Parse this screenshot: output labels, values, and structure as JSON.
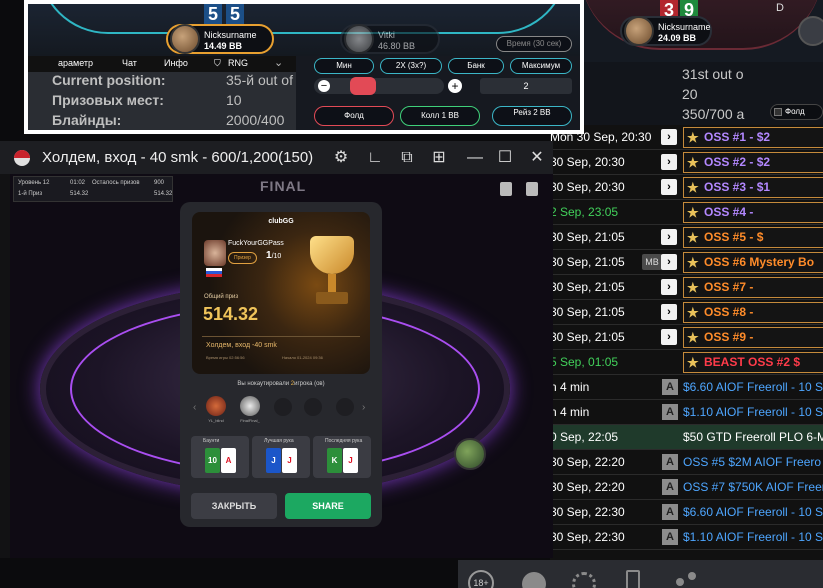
{
  "bg_table": {
    "digits": [
      "3",
      "9"
    ],
    "dealer": "D",
    "player": {
      "name": "Nicksurname",
      "stack": "24.09 BB"
    }
  },
  "lobby": {
    "rows": [
      {
        "date": "Mon 30 Sep, 20:30",
        "name": "OSS #1 - $2",
        "name_color": "#b388ff",
        "type": "star"
      },
      {
        "date": "30 Sep, 20:30",
        "name": "OSS #2 - $2",
        "name_color": "#b388ff",
        "type": "star"
      },
      {
        "date": "30 Sep, 20:30",
        "name": "OSS #3 - $1",
        "name_color": "#b388ff",
        "type": "star"
      },
      {
        "date": "2 Sep, 23:05",
        "date_color": "#42d15b",
        "name": "OSS #4 -",
        "name_color": "#b388ff",
        "type": "star_noarrow"
      },
      {
        "date": "30 Sep, 21:05",
        "name": "OSS #5 - $",
        "name_color": "#ff8c2a",
        "type": "star"
      },
      {
        "date": "30 Sep, 21:05",
        "mb": "MB",
        "name": "OSS #6 Mystery Bo",
        "name_color": "#ff8c2a",
        "type": "star"
      },
      {
        "date": "30 Sep, 21:05",
        "name": "OSS #7 -",
        "name_color": "#ff8c2a",
        "type": "star"
      },
      {
        "date": "30 Sep, 21:05",
        "name": "OSS #8 -",
        "name_color": "#ff8c2a",
        "type": "star"
      },
      {
        "date": "30 Sep, 21:05",
        "name": "OSS #9 -",
        "name_color": "#ff8c2a",
        "type": "star"
      },
      {
        "date": "5 Sep, 01:05",
        "date_color": "#42d15b",
        "name": "BEAST OSS #2 $",
        "name_color": "#ff3b4a",
        "type": "star_noarrow"
      },
      {
        "date": "n 4 min",
        "name": "$6.60 AIOF Freeroll - 10 S",
        "name_color": "#4ea6ff",
        "type": "a"
      },
      {
        "date": "n 4 min",
        "name": "$1.10 AIOF Freeroll - 10 S",
        "name_color": "#4ea6ff",
        "type": "a"
      },
      {
        "date": "0 Sep, 22:05",
        "name": "$50 GTD Freeroll PLO 6-Ma",
        "name_color": "#ffffff",
        "type": "plain",
        "bg": "#1f3a2b"
      },
      {
        "date": "30 Sep, 22:20",
        "name": "OSS #5 $2M AIOF Freero",
        "name_color": "#4ea6ff",
        "type": "a"
      },
      {
        "date": "30 Sep, 22:20",
        "name": "OSS #7 $750K AIOF Freer",
        "name_color": "#4ea6ff",
        "type": "a"
      },
      {
        "date": "30 Sep, 22:30",
        "name": "$6.60 AIOF Freeroll - 10 S",
        "name_color": "#4ea6ff",
        "type": "a"
      },
      {
        "date": "30 Sep, 22:30",
        "name": "$1.10 AIOF Freeroll - 10 S",
        "name_color": "#4ea6ff",
        "type": "a"
      }
    ],
    "bottom_badge": "18+"
  },
  "info_panel": {
    "digits": [
      "5",
      "5"
    ],
    "hero": {
      "name": "Nicksurname",
      "stack": "14.49 BB"
    },
    "villain": {
      "name": "Vitki",
      "stack": "46.80 BB"
    },
    "time_button": "Время (30 сек)",
    "menu": [
      "араметр",
      "Чат",
      "Инфо",
      "RNG"
    ],
    "bet_presets": [
      "Мин",
      "2X (3x?)",
      "Банк",
      "Максимум"
    ],
    "bet_value": "2",
    "actions": [
      "Фолд",
      "Колл 1 BB",
      "Рейз 2 BB"
    ],
    "stats": [
      {
        "label": "Current position:",
        "value": "35-й out of"
      },
      {
        "label": "Призовых мест:",
        "value": "10"
      },
      {
        "label": "Блайнды:",
        "value": "2000/400"
      }
    ],
    "right_stats": [
      "31st out o",
      "20",
      "350/700 a"
    ],
    "right_fold": "Фолд"
  },
  "window": {
    "title": "Холдем, вход - 40 smk - 600/1,200(150)",
    "hud": {
      "level_label": "Уровень 12",
      "time": "01:02",
      "left_label": "Осталось призов",
      "left_value": "900",
      "prize_label": "1-й Приз",
      "prize_value": "514.32",
      "sub_value": "514.32"
    },
    "table_banner": "FINAL"
  },
  "summary": {
    "brand": "clubGG",
    "player_name": "FuckYourGGPass",
    "place_badge": "Призер",
    "place": "1",
    "place_total": "/10",
    "prize_label": "Общий приз",
    "prize": "514.32",
    "tournament": "Холдем, вход -40 smk",
    "time_label": "Время игры 02:56:56",
    "date": "Начало 01-2024 09:36",
    "knockout_text": "Вы нокаутировали",
    "knockout_count": "2",
    "knockout_tail": "игрока (ов)",
    "ko_players": [
      "YL_blind",
      "FinalFinal_"
    ],
    "stats": [
      {
        "label": "Баунти",
        "cards": [
          "10",
          "A"
        ]
      },
      {
        "label": "Лучшая рука",
        "cards": [
          "J",
          "J"
        ]
      },
      {
        "label": "Последняя рука",
        "cards": [
          "K",
          "J"
        ]
      }
    ],
    "close_button": "ЗАКРЫТЬ",
    "share_button": "SHARE"
  }
}
